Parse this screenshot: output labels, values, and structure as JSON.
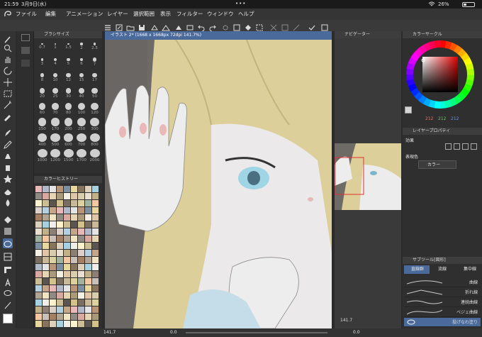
{
  "status": {
    "time": "21:59",
    "date": "3月9日(水)",
    "battery": "26%",
    "dots": "•••"
  },
  "menu": [
    "ファイル",
    "編集",
    "アニメーション",
    "レイヤー",
    "選択範囲",
    "表示",
    "フィルター",
    "ウィンドウ",
    "ヘルプ"
  ],
  "panels": {
    "brush_size": "ブラシサイズ",
    "color_history": "カラーヒストリー",
    "navigator": "ナビゲーター",
    "color_circle": "カラーサークル",
    "layer_property": "レイヤープロパティ",
    "sub_tool": "サブツール[図形]"
  },
  "document_tab": "イラスト 2* (1668 x 1668px 72dpi 141.7%)",
  "brush_sizes": [
    "0.7",
    "1",
    "1.5",
    "2",
    "2.5",
    "3",
    "4",
    "5",
    "6",
    "7",
    "8",
    "10",
    "12",
    "15",
    "17",
    "20",
    "25",
    "30",
    "40",
    "50",
    "60",
    "70",
    "80",
    "100",
    "120",
    "150",
    "170",
    "200",
    "250",
    "300",
    "400",
    "500",
    "600",
    "700",
    "800",
    "1000",
    "1200",
    "1500",
    "1700",
    "2000"
  ],
  "color_circle": {
    "r": "212",
    "g": "212",
    "b": "212",
    "accent": "#d4d4d4"
  },
  "layer_property": {
    "effect_label": "効果",
    "color_label": "表現色",
    "color_value": "カラー"
  },
  "sub_tool": {
    "tabs": [
      "直線群",
      "流線",
      "集中線"
    ],
    "items": [
      "曲線",
      "折れ線",
      "連続曲線",
      "ベジェ曲線",
      "投げなわ塗り"
    ]
  },
  "navigator_zoom": "141.7",
  "navigator_angle": "0.0",
  "bottom": {
    "zoom": "141.7",
    "angle": "0.0"
  }
}
